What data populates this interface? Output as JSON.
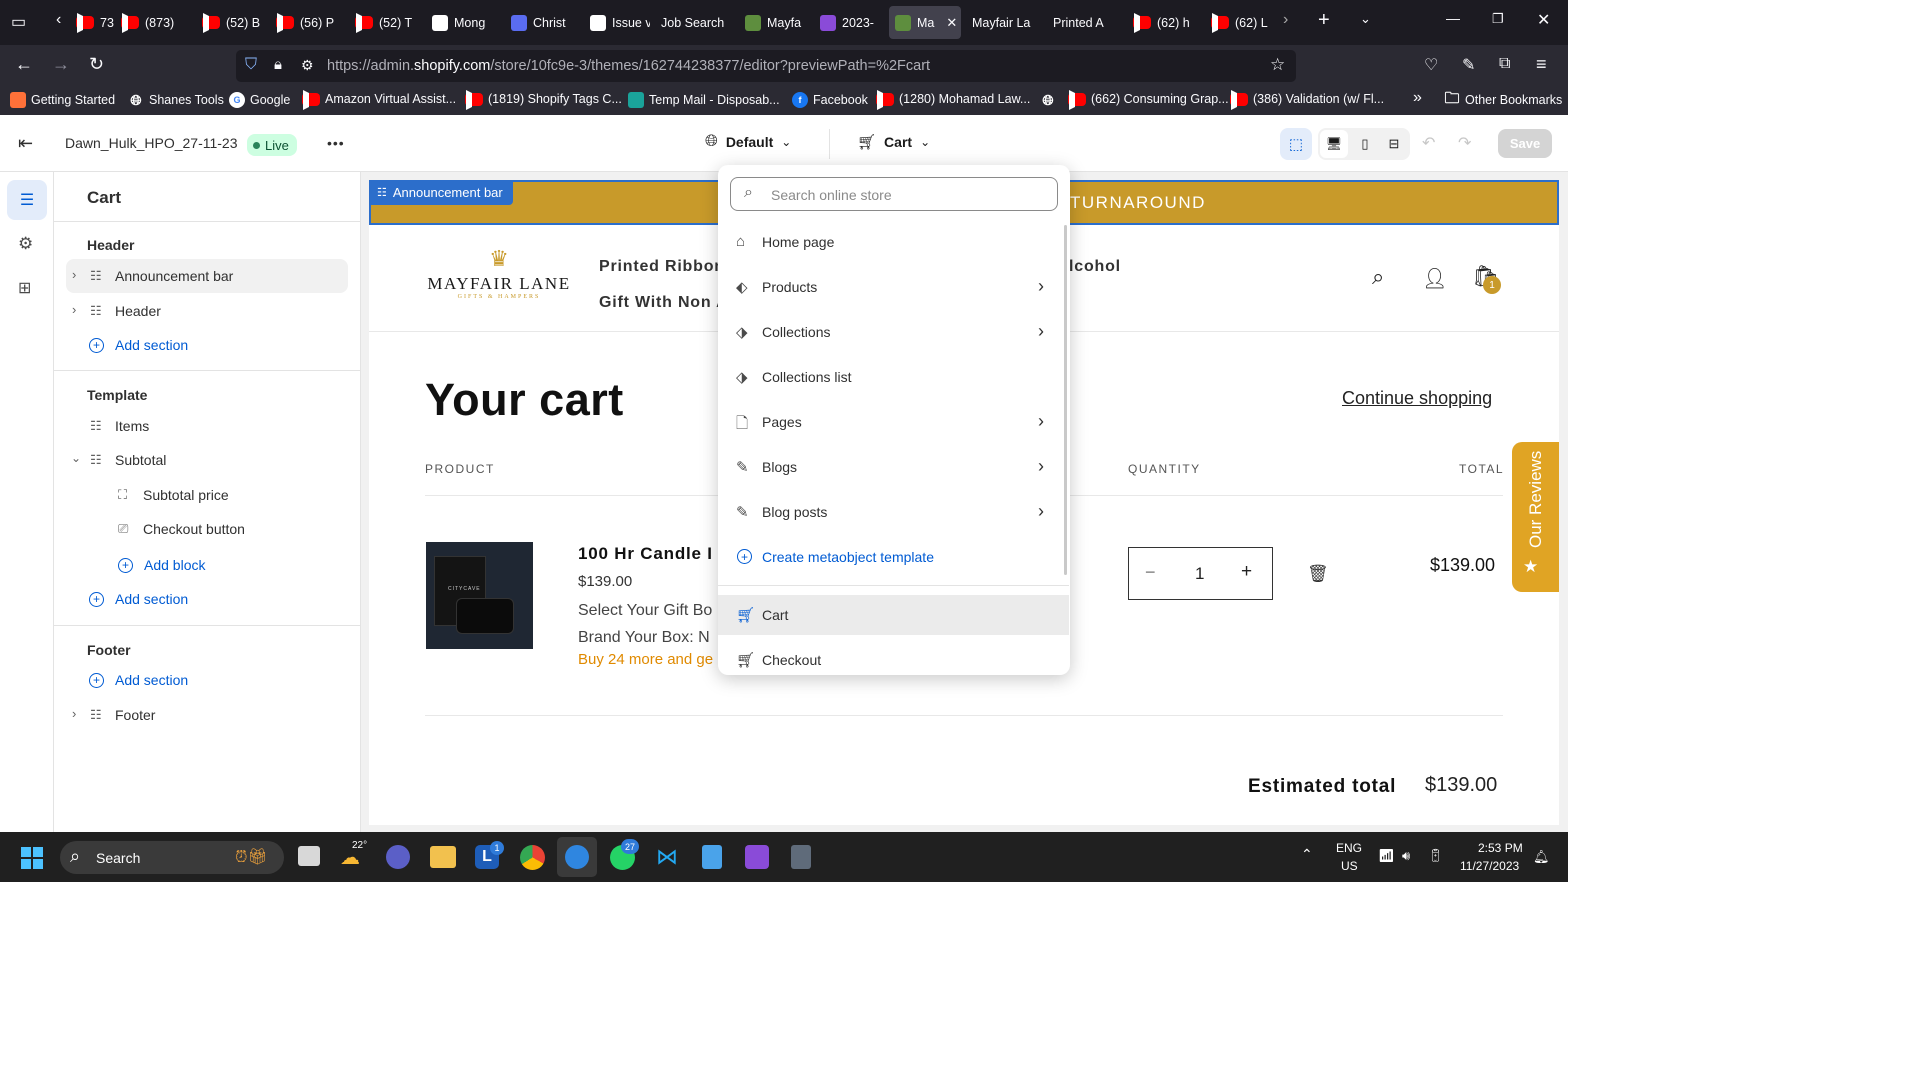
{
  "browser": {
    "tabs": [
      {
        "label": "73)",
        "icon": "youtube-icon"
      },
      {
        "label": "(873)",
        "icon": "youtube-icon"
      },
      {
        "label": "(52) B",
        "icon": "youtube-icon"
      },
      {
        "label": "(56) P",
        "icon": "youtube-icon"
      },
      {
        "label": "(52) T",
        "icon": "youtube-icon"
      },
      {
        "label": "Mong",
        "icon": "mongo-icon"
      },
      {
        "label": "Christ",
        "icon": "c-icon"
      },
      {
        "label": "Issue v",
        "icon": "gmail-icon"
      },
      {
        "label": "Job Search",
        "icon": "none"
      },
      {
        "label": "Mayfa",
        "icon": "shopify-icon"
      },
      {
        "label": "2023-",
        "icon": "purple-icon"
      },
      {
        "label": "Ma",
        "icon": "shopify-icon"
      },
      {
        "label": "Mayfair La",
        "icon": "none"
      },
      {
        "label": "Printed A",
        "icon": "none"
      },
      {
        "label": "(62) h",
        "icon": "youtube-icon"
      },
      {
        "label": "(62) L",
        "icon": "youtube-icon"
      }
    ],
    "url": "https://admin.shopify.com/store/10fc9e-3/themes/162744238377/editor?previewPath=%2Fcart",
    "url_domain": "shopify.com",
    "url_prefix": "https://admin.",
    "url_suffix": "/store/10fc9e-3/themes/162744238377/editor?previewPath=%2Fcart",
    "bookmarks": [
      "Getting Started",
      "Shanes Tools",
      "Google",
      "Amazon Virtual Assist...",
      "(1819) Shopify Tags C...",
      "Temp Mail - Disposab...",
      "Facebook",
      "(1280) Mohamad Law...",
      "",
      "(662) Consuming Grap...",
      "(386) Validation (w/ Fl...",
      "Other Bookmarks"
    ]
  },
  "editor": {
    "theme_name": "Dawn_Hulk_HPO_27-11-23",
    "status": "Live",
    "more": "•••",
    "language": "Default",
    "template": "Cart",
    "save": "Save"
  },
  "sidebar": {
    "title": "Cart",
    "header_group": "Header",
    "announcement_bar": "Announcement bar",
    "header_item": "Header",
    "add_section": "Add section",
    "template_group": "Template",
    "items": "Items",
    "subtotal": "Subtotal",
    "subtotal_price": "Subtotal price",
    "checkout_button": "Checkout button",
    "add_block": "Add block",
    "footer_group": "Footer",
    "footer_item": "Footer"
  },
  "dropdown": {
    "search_placeholder": "Search online store",
    "items": [
      {
        "label": "Home page",
        "icon": "home-icon",
        "arrow": false
      },
      {
        "label": "Products",
        "icon": "tag-icon",
        "arrow": true
      },
      {
        "label": "Collections",
        "icon": "collections-icon",
        "arrow": true
      },
      {
        "label": "Collections list",
        "icon": "collections-icon",
        "arrow": false
      },
      {
        "label": "Pages",
        "icon": "page-icon",
        "arrow": true
      },
      {
        "label": "Blogs",
        "icon": "blog-icon",
        "arrow": true
      },
      {
        "label": "Blog posts",
        "icon": "blog-icon",
        "arrow": true
      }
    ],
    "create_metaobject": "Create metaobject template",
    "cart": "Cart",
    "checkout": "Checkout"
  },
  "preview": {
    "announcement_tag": "Announcement bar",
    "announcement_text": "TURNAROUND",
    "logo_main": "MAYFAIR LANE",
    "logo_sub": "GIFTS & HAMPERS",
    "nav1a": "Printed Ribbon",
    "nav1b": "lcohol",
    "nav2": "Gift With Non A",
    "cart_count": "1",
    "heading": "Your cart",
    "continue": "Continue shopping",
    "col_product": "PRODUCT",
    "col_quantity": "QUANTITY",
    "col_total": "TOTAL",
    "product_name": "100 Hr Candle I",
    "product_price": "$139.00",
    "option1": "Select Your Gift Bo",
    "option2": "Brand Your Box: N",
    "promo": "Buy 24 more and ge",
    "quantity": "1",
    "line_total": "$139.00",
    "estimated_label": "Estimated total",
    "estimated_value": "$139.00",
    "reviews_tab": "Our Reviews",
    "candle_brand": "CITYCAVE"
  },
  "taskbar": {
    "search": "Search",
    "weather": "22°",
    "lang1": "ENG",
    "lang2": "US",
    "time": "2:53 PM",
    "date": "11/27/2023",
    "badge_l": "1",
    "badge_wa": "27"
  },
  "colors": {
    "announcement": "#c89a2a",
    "accent_blue": "#005bd3",
    "live_green": "#29845a",
    "browser_dark": "#1c1b22"
  }
}
